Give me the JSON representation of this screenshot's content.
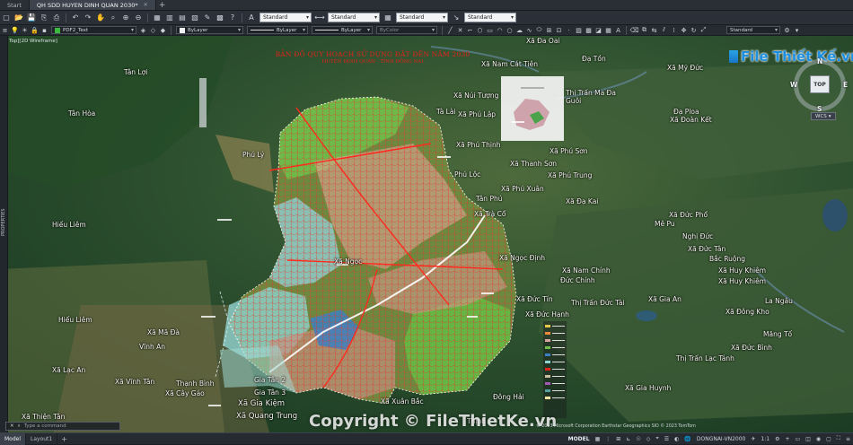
{
  "tabs": [
    {
      "label": "Start",
      "active": false,
      "closable": false
    },
    {
      "label": "QH SDD HUYEN DINH QUAN 2030*",
      "active": true,
      "closable": true
    }
  ],
  "toolbar": {
    "textstyle": "Standard",
    "dimstyle": "Standard",
    "tablestyle": "Standard",
    "mleaderstyle": "Standard",
    "layer": "PDF2_Text",
    "color": "ByLayer",
    "linetype": "ByLayer",
    "lineweight": "ByLayer",
    "plotstyle": "ByColor",
    "visualstyle": "Standard"
  },
  "viewport_label": "Top][2D Wireframe]",
  "map": {
    "title": "BẢN ĐỒ QUY HOẠCH SỬ DỤNG ĐẤT ĐẾN NĂM 2030",
    "subtitle": "HUYỆN ĐỊNH QUÁN - TỈNH ĐỒNG NAI",
    "places": [
      {
        "name": "Xã Đa Oai",
        "big": false
      },
      {
        "name": "Xã Nam Cát Tiên",
        "big": false
      },
      {
        "name": "Đạ Tồn",
        "big": false
      },
      {
        "name": "Xã Mỹ Đức",
        "big": false
      },
      {
        "name": "Tân Lợi",
        "big": false
      },
      {
        "name": "Tân Hòa",
        "big": false
      },
      {
        "name": "Xã Núi Tượng",
        "big": false
      },
      {
        "name": "Tà Lài",
        "big": false
      },
      {
        "name": "Xã Phú Lập",
        "big": false
      },
      {
        "name": "Thị Trấn Ma Đa Guôi",
        "big": false
      },
      {
        "name": "Đạ Ploa",
        "big": false
      },
      {
        "name": "Xã Đoàn Kết",
        "big": false
      },
      {
        "name": "Xã Phú Thịnh",
        "big": false
      },
      {
        "name": "Xã Phú Sơn",
        "big": false
      },
      {
        "name": "Xã Thanh Sơn",
        "big": false
      },
      {
        "name": "Phú Lộc",
        "big": false
      },
      {
        "name": "Xã Phú Trung",
        "big": false
      },
      {
        "name": "Xã Phú Xuân",
        "big": false
      },
      {
        "name": "Tân Phú",
        "big": false
      },
      {
        "name": "Xã Đạ Kai",
        "big": false
      },
      {
        "name": "Xã Trà Cổ",
        "big": false
      },
      {
        "name": "Hiếu Liêm",
        "big": false
      },
      {
        "name": "Xã Đức Phổ",
        "big": false
      },
      {
        "name": "Mê Pu",
        "big": false
      },
      {
        "name": "Nghị Đức",
        "big": false
      },
      {
        "name": "Xã Đức Tân",
        "big": false
      },
      {
        "name": "Bắc Ruộng",
        "big": false
      },
      {
        "name": "Xã Nam Chính",
        "big": false
      },
      {
        "name": "Xã Huy Khiêm",
        "big": false
      },
      {
        "name": "Đức Chính",
        "big": false
      },
      {
        "name": "Xã Huy Khiêm",
        "big": false
      },
      {
        "name": "Xã Ngọc Định",
        "big": false
      },
      {
        "name": "Xã Đức Tín",
        "big": false
      },
      {
        "name": "Thị Trấn Đức Tài",
        "big": false
      },
      {
        "name": "Xã Gia An",
        "big": false
      },
      {
        "name": "La Ngâu",
        "big": false
      },
      {
        "name": "Xã Đức Hạnh",
        "big": false
      },
      {
        "name": "Hiếu Liêm",
        "big": false
      },
      {
        "name": "Xã Đông Kho",
        "big": false
      },
      {
        "name": "Xã Mã Đà",
        "big": false
      },
      {
        "name": "Vĩnh An",
        "big": false
      },
      {
        "name": "Măng Tố",
        "big": false
      },
      {
        "name": "Xã Đức Bình",
        "big": false
      },
      {
        "name": "Thị Trấn Lạc Tánh",
        "big": false
      },
      {
        "name": "Xã Lạc An",
        "big": false
      },
      {
        "name": "Xã Vĩnh Tân",
        "big": false
      },
      {
        "name": "Thạnh Bình",
        "big": false
      },
      {
        "name": "Xã Cây Gáo",
        "big": false
      },
      {
        "name": "Gia Tân 2",
        "big": false
      },
      {
        "name": "Gia Tân 3",
        "big": false
      },
      {
        "name": "Xã Gia Huynh",
        "big": false
      },
      {
        "name": "Xã Xuân Bắc",
        "big": false
      },
      {
        "name": "Đông Hải",
        "big": false
      },
      {
        "name": "Xã Gia Kiệm",
        "big": true
      },
      {
        "name": "Xã Thiện Tân",
        "big": false
      },
      {
        "name": "Xã Quang Trung",
        "big": true
      },
      {
        "name": "Xã Ngọc",
        "big": false
      },
      {
        "name": "Phú Lý",
        "big": false
      },
      {
        "name": "Thịnh",
        "big": false
      }
    ]
  },
  "panel": {
    "properties_label": "PROPERTIES"
  },
  "viewcube": {
    "face": "TOP",
    "n": "N",
    "s": "S",
    "w": "W",
    "e": "E"
  },
  "wcs": "WCS",
  "cmdline": {
    "placeholder": "Type a command"
  },
  "watermark": "Copyright © FileThietKe.vn",
  "logo": "File Thiết Kế.vn",
  "attribution": "© 2023 Microsoft Corporation Earthstar Geographics SIO © 2023 TomTom",
  "layouts": [
    {
      "label": "Model",
      "active": true
    },
    {
      "label": "Layout1",
      "active": false
    }
  ],
  "status": {
    "space": "MODEL",
    "coordsys": "DONGNAI-VN2000",
    "scale": "1:1"
  },
  "colors": {
    "accent": "#1d8fe0",
    "title_red": "#e2231a",
    "boundary_red": "#e2231a"
  }
}
